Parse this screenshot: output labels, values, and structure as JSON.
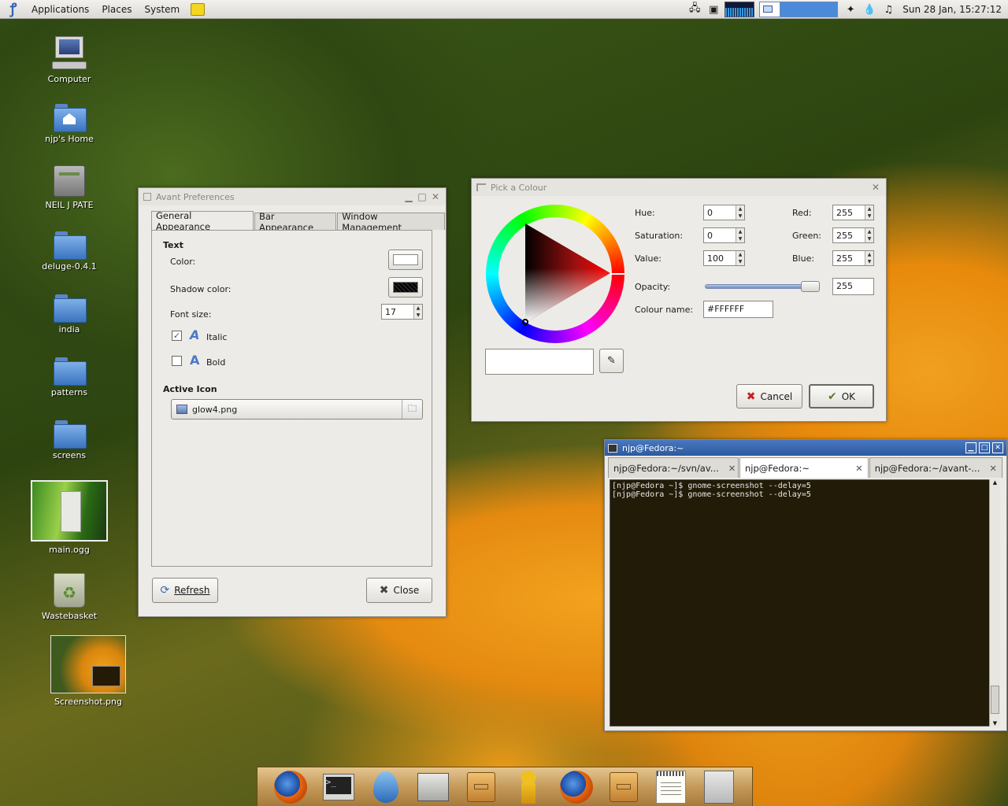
{
  "top_panel": {
    "menus": [
      "Applications",
      "Places",
      "System"
    ],
    "clock": "Sun 28 Jan, 15:27:12"
  },
  "desktop_icons": [
    {
      "label": "Computer",
      "icon": "computer-icon"
    },
    {
      "label": "njp's Home",
      "icon": "home-folder-icon"
    },
    {
      "label": "NEIL J PATE",
      "icon": "drive-icon"
    },
    {
      "label": "deluge-0.4.1",
      "icon": "folder-icon"
    },
    {
      "label": "india",
      "icon": "folder-icon"
    },
    {
      "label": "patterns",
      "icon": "folder-icon"
    },
    {
      "label": "screens",
      "icon": "folder-icon"
    },
    {
      "label": "main.ogg",
      "icon": "video-thumbnail"
    },
    {
      "label": "Wastebasket",
      "icon": "trash-icon"
    },
    {
      "label": "Screenshot.png",
      "icon": "image-thumbnail"
    }
  ],
  "avant": {
    "title": "Avant Preferences",
    "tabs": [
      "General Appearance",
      "Bar Appearance",
      "Window Management"
    ],
    "text_section": "Text",
    "color_label": "Color:",
    "shadow_label": "Shadow color:",
    "font_size_label": "Font size:",
    "font_size": "17",
    "italic_label": "Italic",
    "italic_checked": true,
    "bold_label": "Bold",
    "bold_checked": false,
    "active_icon_section": "Active Icon",
    "active_icon_file": "glow4.png",
    "refresh": "Refresh",
    "close": "Close",
    "color_value": "#FFFFFF",
    "shadow_value": "#000000"
  },
  "picker": {
    "title": "Pick a Colour",
    "hue_label": "Hue:",
    "hue": "0",
    "sat_label": "Saturation:",
    "sat": "0",
    "val_label": "Value:",
    "val": "100",
    "red_label": "Red:",
    "red": "255",
    "green_label": "Green:",
    "green": "255",
    "blue_label": "Blue:",
    "blue": "255",
    "opacity_label": "Opacity:",
    "opacity": "255",
    "name_label": "Colour name:",
    "name": "#FFFFFF",
    "cancel": "Cancel",
    "ok": "OK"
  },
  "terminal": {
    "title": "njp@Fedora:~",
    "tabs": [
      "njp@Fedora:~/svn/av...",
      "njp@Fedora:~",
      "njp@Fedora:~/avant-..."
    ],
    "lines": [
      "[njp@Fedora ~]$ gnome-screenshot --delay=5",
      "[njp@Fedora ~]$ gnome-screenshot --delay=5"
    ]
  },
  "colors": {
    "panel_bg": "#dcdad5",
    "window_bg": "#edebe7",
    "terminal_bg": "#221b08",
    "accent": "#3464b4"
  }
}
